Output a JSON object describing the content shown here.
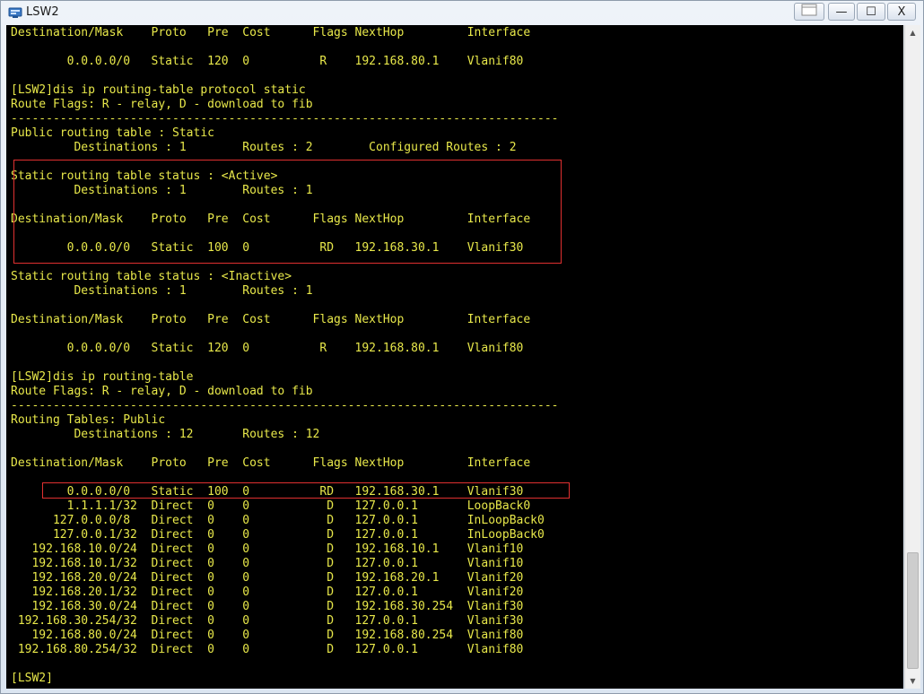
{
  "window": {
    "title": "LSW2"
  },
  "controls": {
    "restore": "",
    "minimize": "—",
    "maximize": "☐",
    "close": "X"
  },
  "terminal": {
    "lines": [
      "Destination/Mask    Proto   Pre  Cost      Flags NextHop         Interface",
      "",
      "        0.0.0.0/0   Static  120  0          R    192.168.80.1    Vlanif80",
      "",
      "[LSW2]dis ip routing-table protocol static",
      "Route Flags: R - relay, D - download to fib",
      "------------------------------------------------------------------------------",
      "Public routing table : Static",
      "         Destinations : 1        Routes : 2        Configured Routes : 2",
      "",
      "Static routing table status : <Active>",
      "         Destinations : 1        Routes : 1",
      "",
      "Destination/Mask    Proto   Pre  Cost      Flags NextHop         Interface",
      "",
      "        0.0.0.0/0   Static  100  0          RD   192.168.30.1    Vlanif30",
      "",
      "Static routing table status : <Inactive>",
      "         Destinations : 1        Routes : 1",
      "",
      "Destination/Mask    Proto   Pre  Cost      Flags NextHop         Interface",
      "",
      "        0.0.0.0/0   Static  120  0          R    192.168.80.1    Vlanif80",
      "",
      "[LSW2]dis ip routing-table",
      "Route Flags: R - relay, D - download to fib",
      "------------------------------------------------------------------------------",
      "Routing Tables: Public",
      "         Destinations : 12       Routes : 12",
      "",
      "Destination/Mask    Proto   Pre  Cost      Flags NextHop         Interface",
      "",
      "        0.0.0.0/0   Static  100  0          RD   192.168.30.1    Vlanif30",
      "        1.1.1.1/32  Direct  0    0           D   127.0.0.1       LoopBack0",
      "      127.0.0.0/8   Direct  0    0           D   127.0.0.1       InLoopBack0",
      "      127.0.0.1/32  Direct  0    0           D   127.0.0.1       InLoopBack0",
      "   192.168.10.0/24  Direct  0    0           D   192.168.10.1    Vlanif10",
      "   192.168.10.1/32  Direct  0    0           D   127.0.0.1       Vlanif10",
      "   192.168.20.0/24  Direct  0    0           D   192.168.20.1    Vlanif20",
      "   192.168.20.1/32  Direct  0    0           D   127.0.0.1       Vlanif20",
      "   192.168.30.0/24  Direct  0    0           D   192.168.30.254  Vlanif30",
      " 192.168.30.254/32  Direct  0    0           D   127.0.0.1       Vlanif30",
      "   192.168.80.0/24  Direct  0    0           D   192.168.80.254  Vlanif80",
      " 192.168.80.254/32  Direct  0    0           D   127.0.0.1       Vlanif80",
      "",
      "[LSW2]"
    ]
  },
  "colors": {
    "text": "#e8e84a",
    "background": "#000000",
    "highlight": "#e03030"
  }
}
